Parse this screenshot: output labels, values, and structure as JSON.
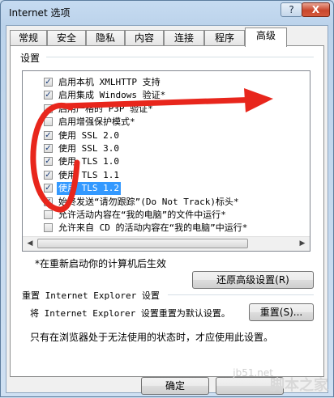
{
  "window": {
    "title": "Internet 选项",
    "help_glyph": "?",
    "close_glyph": "X"
  },
  "tabs": [
    "常规",
    "安全",
    "隐私",
    "内容",
    "连接",
    "程序",
    "高级"
  ],
  "active_tab": "高级",
  "settings": {
    "label": "设置",
    "items": [
      {
        "label": "启用本机 XMLHTTP 支持",
        "checked": true
      },
      {
        "label": "启用集成 Windows 验证*",
        "checked": true
      },
      {
        "label": "启用严格的 P3P 验证*",
        "checked": false
      },
      {
        "label": "启用增强保护模式*",
        "checked": false
      },
      {
        "label": "使用 SSL 2.0",
        "checked": true
      },
      {
        "label": "使用 SSL 3.0",
        "checked": true
      },
      {
        "label": "使用 TLS 1.0",
        "checked": true
      },
      {
        "label": "使用 TLS 1.1",
        "checked": true
      },
      {
        "label": "使用 TLS 1.2",
        "checked": true,
        "selected": true
      },
      {
        "label": "始终发送“请勿跟踪”(Do Not Track)标头*",
        "checked": true
      },
      {
        "label": "允许活动内容在“我的电脑”的文件中运行*",
        "checked": false
      },
      {
        "label": "允许来自 CD 的活动内容在“我的电脑”中运行*",
        "checked": false
      }
    ],
    "restart_note": "*在重新启动你的计算机后生效",
    "restore_button": "还原高级设置(R)"
  },
  "reset": {
    "group_label": "重置 Internet Explorer 设置",
    "description": "将 Internet Explorer 设置重置为默认设置。",
    "button": "重置(S)...",
    "note": "只有在浏览器处于无法使用的状态时，才应使用此设置。"
  },
  "footer": {
    "ok_button": "确定"
  },
  "watermark": {
    "site": "jb51.net",
    "name": "脚本之家"
  },
  "colors": {
    "selection": "#3399ff",
    "annotation_arrow": "#e8261c"
  }
}
